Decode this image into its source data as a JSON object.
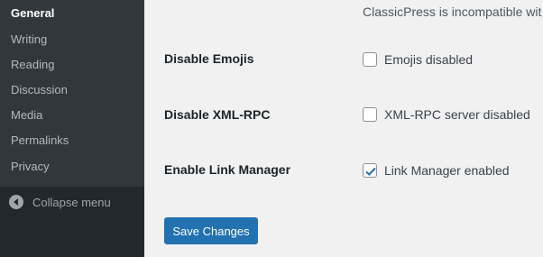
{
  "sidebar": {
    "items": [
      {
        "label": "General",
        "current": true
      },
      {
        "label": "Writing"
      },
      {
        "label": "Reading"
      },
      {
        "label": "Discussion"
      },
      {
        "label": "Media"
      },
      {
        "label": "Permalinks"
      },
      {
        "label": "Privacy"
      }
    ],
    "collapse_label": "Collapse menu",
    "collapse_icon": "collapse-arrow-icon"
  },
  "main": {
    "notice": "ClassicPress is incompatible wit",
    "settings": [
      {
        "label": "Disable Emojis",
        "option": "Emojis disabled",
        "checked": false
      },
      {
        "label": "Disable XML-RPC",
        "option": "XML-RPC server disabled",
        "checked": false
      },
      {
        "label": "Enable Link Manager",
        "option": "Link Manager enabled",
        "checked": true
      }
    ],
    "save_label": "Save Changes"
  },
  "colors": {
    "sidebar_bg": "#23282d",
    "submenu_bg": "#32373c",
    "accent": "#2271b1",
    "content_bg": "#f1f1f1"
  }
}
